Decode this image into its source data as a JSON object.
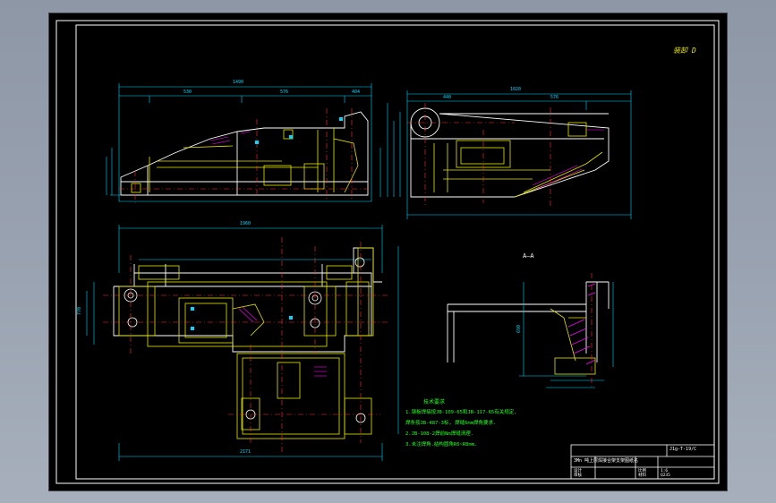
{
  "colors": {
    "background": "#9aa3b1",
    "sheet": "#000000",
    "outline": "#ffffff",
    "part": "#e6e600",
    "dimension": "#00d8ff",
    "centerline": "#ff3030",
    "hatch": "#ff00ff",
    "notes": "#22ff22"
  },
  "corner_mark": "装卸 D",
  "section_label": "A—A",
  "notes": {
    "title": "技术要求",
    "lines": [
      "1.钢板焊接按JB-109-65和JB-117-65有关规定,",
      "  焊条按JB-487-3标, 焊缝6mm焊角要求.",
      "2.JB-108-2焊前Nm焊缝清理.",
      "3.未注焊角.结构圆角R6~R8mm."
    ]
  },
  "title_block": {
    "code": "J1g-T-19/C",
    "name": "3Mn 吨上层焊接合架支架图纸名",
    "row1": [
      "设计",
      "",
      "比例",
      "1:6"
    ],
    "row2": [
      "审核",
      "",
      "材料",
      "Q235"
    ]
  },
  "dims": {
    "front_top": "1490",
    "front_sub": [
      "530",
      "576",
      "404"
    ],
    "side_top": "1020",
    "side_sub": [
      "440",
      "576"
    ],
    "plan_top": "1960",
    "plan_bottom": "2171",
    "plan_left": "770",
    "section_height": "690"
  }
}
